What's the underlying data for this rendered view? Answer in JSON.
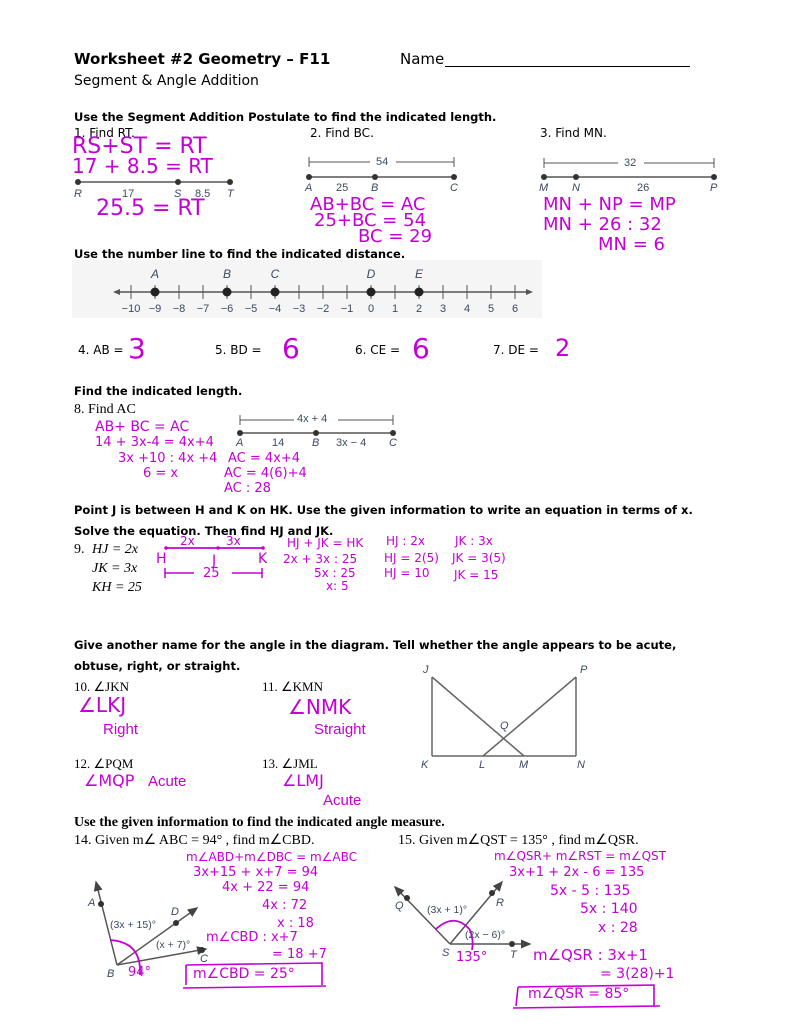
{
  "header": {
    "title": "Worksheet #2 Geometry – F11",
    "name_label": "Name",
    "subtitle": "Segment & Angle Addition"
  },
  "section1": {
    "instruction": "Use the Segment Addition Postulate to find the indicated length.",
    "p1": {
      "label": "1.  Find RT.",
      "points": [
        "R",
        "S",
        "T"
      ],
      "segments": [
        "17",
        "8.5"
      ],
      "work": [
        "RS+ST = RT",
        "17 + 8.5 = RT",
        "25.5 = RT"
      ]
    },
    "p2": {
      "label": "2.  Find BC.",
      "points": [
        "A",
        "B",
        "C"
      ],
      "total": "54",
      "segments": [
        "25"
      ],
      "work": [
        "AB+BC = AC",
        "25+BC = 54",
        "BC = 29"
      ]
    },
    "p3": {
      "label": "3.  Find MN.",
      "points": [
        "M",
        "N",
        "P"
      ],
      "total": "32",
      "segments": [
        "26"
      ],
      "work": [
        "MN + NP = MP",
        "MN + 26 : 32",
        "MN = 6"
      ]
    }
  },
  "section2": {
    "instruction": "Use the number line to find the indicated distance.",
    "number_line": {
      "min": -10,
      "max": 6,
      "ticks": [
        "−10",
        "−9",
        "−8",
        "−7",
        "−6",
        "−5",
        "−4",
        "−3",
        "−2",
        "−1",
        "0",
        "1",
        "2",
        "3",
        "4",
        "5",
        "6"
      ],
      "points": [
        {
          "label": "A",
          "value": -9
        },
        {
          "label": "B",
          "value": -6
        },
        {
          "label": "C",
          "value": -4
        },
        {
          "label": "D",
          "value": 0
        },
        {
          "label": "E",
          "value": 2
        }
      ]
    },
    "questions": [
      {
        "label": "4.  AB =",
        "answer": "3"
      },
      {
        "label": "5.  BD  =",
        "answer": "6"
      },
      {
        "label": "6.  CE =",
        "answer": "6"
      },
      {
        "label": "7.  DE =",
        "answer": "2"
      }
    ]
  },
  "section3": {
    "instruction": "Find the indicated length.",
    "p8": {
      "label": "8.   Find AC",
      "total": "4x + 4",
      "points": [
        "A",
        "B",
        "C"
      ],
      "segments": [
        "14",
        "3x − 4"
      ],
      "work_left": [
        "AB+ BC = AC",
        "14 + 3x-4 = 4x+4",
        "3x +10 : 4x +4",
        "6 = x"
      ],
      "work_right": [
        "AC = 4x+4",
        "AC = 4(6)+4",
        "AC : 28"
      ]
    }
  },
  "section4": {
    "instruction_line1": "Point J is between H and K on HK.  Use the given information to write an equation in terms of x.",
    "instruction_line2": "Solve the equation.  Then find HJ and JK.",
    "p9": {
      "number": "9.",
      "givens": [
        "HJ = 2x",
        "JK = 3x",
        "KH = 25"
      ],
      "sketch": {
        "top": [
          "2x",
          "3x"
        ],
        "points": [
          "H",
          "J",
          "K"
        ],
        "bottom": "25"
      },
      "work_a": [
        "HJ + JK = HK",
        "2x + 3x : 25",
        "5x : 25",
        "x: 5"
      ],
      "work_b": [
        "HJ : 2x",
        "HJ = 2(5)",
        "HJ = 10"
      ],
      "work_c": [
        "JK : 3x",
        "JK = 3(5)",
        "JK = 15"
      ]
    }
  },
  "section5": {
    "instruction_line1": "Give another name for the angle in the diagram.  Tell whether the angle appears to be acute,",
    "instruction_line2": "obtuse, right, or straight.",
    "questions": [
      {
        "label": "10.  ∠JKN",
        "name": "∠LKJ",
        "type": "Right"
      },
      {
        "label": "11.  ∠KMN",
        "name": "∠NMK",
        "type": "Straight"
      },
      {
        "label": "12.  ∠PQM",
        "name": "∠MQP",
        "type": "Acute"
      },
      {
        "label": "13.  ∠JML",
        "name": "∠LMJ",
        "type": "Acute"
      }
    ],
    "diagram_points": [
      "J",
      "P",
      "Q",
      "K",
      "L",
      "M",
      "N"
    ]
  },
  "section6": {
    "instruction": "Use the given information to find the indicated angle measure.",
    "p14": {
      "label": "14.  Given m∠ ABC = 94° , find m∠CBD.",
      "points": [
        "A",
        "D",
        "C",
        "B"
      ],
      "angle_labels": [
        "(3x + 15)°",
        "(x + 7)°"
      ],
      "marked": "94°",
      "work": [
        "m∠ABD+m∠DBC = m∠ABC",
        "3x+15 + x+7 = 94",
        "4x + 22 = 94",
        "4x : 72",
        "x : 18",
        "m∠CBD : x+7",
        "= 18 +7"
      ],
      "answer": "m∠CBD = 25°"
    },
    "p15": {
      "label": "15.  Given m∠QST = 135° , find m∠QSR.",
      "points": [
        "Q",
        "R",
        "S",
        "T"
      ],
      "angle_labels": [
        "(3x + 1)°",
        "(2x − 6)°"
      ],
      "marked": "135°",
      "work": [
        "m∠QSR+ m∠RST = m∠QST",
        "3x+1 + 2x - 6 = 135",
        "5x - 5 : 135",
        "5x : 140",
        "x : 28",
        "m∠QSR : 3x+1",
        "= 3(28)+1"
      ],
      "answer": "m∠QSR = 85°"
    }
  }
}
